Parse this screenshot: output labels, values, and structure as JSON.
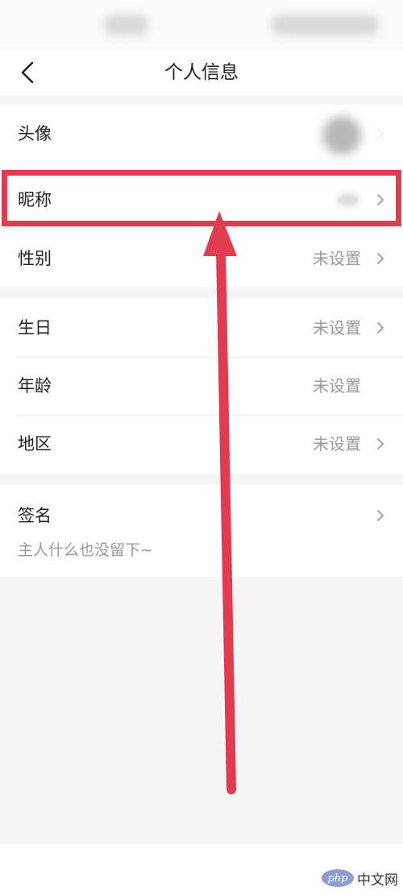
{
  "header": {
    "title": "个人信息",
    "back_icon": "chevron-left-icon"
  },
  "rows": {
    "avatar": {
      "label": "头像"
    },
    "nickname": {
      "label": "昵称"
    },
    "gender": {
      "label": "性别",
      "value": "未设置"
    },
    "birthday": {
      "label": "生日",
      "value": "未设置"
    },
    "age": {
      "label": "年龄",
      "value": "未设置"
    },
    "region": {
      "label": "地区",
      "value": "未设置"
    }
  },
  "signature": {
    "label": "签名",
    "placeholder": "主人什么也没留下~"
  },
  "annotation": {
    "color": "#e23a4f"
  },
  "watermark": {
    "logo": "php",
    "text": "中文网"
  }
}
